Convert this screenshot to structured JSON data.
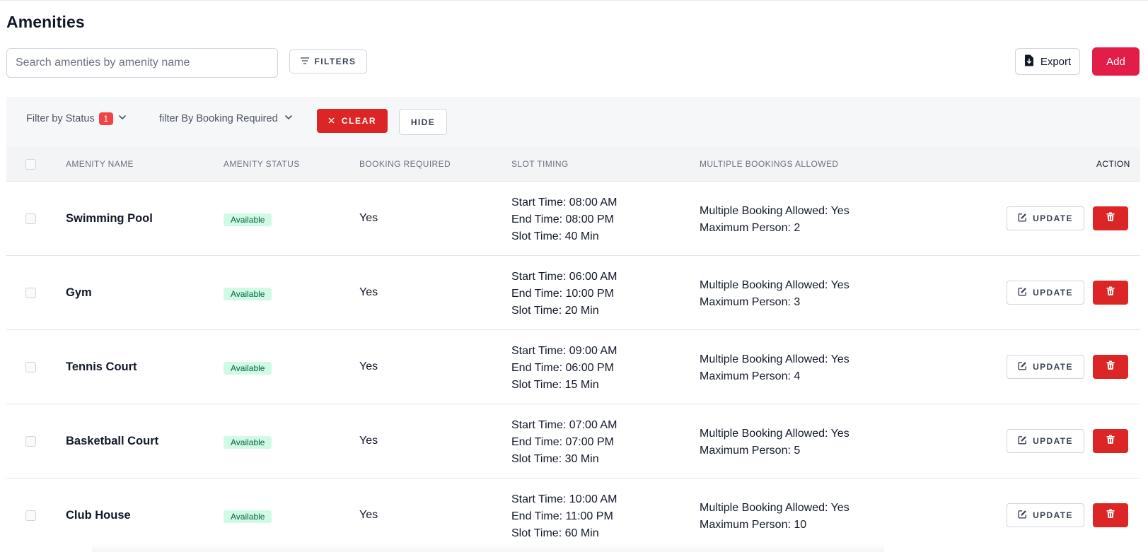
{
  "page": {
    "title": "Amenities"
  },
  "toolbar": {
    "search_placeholder": "Search amenties by amenity name",
    "filters_label": "FILTERS",
    "export_label": "Export",
    "add_label": "Add"
  },
  "filter_bar": {
    "status_label": "Filter by Status",
    "status_count": "1",
    "booking_label": "filter By Booking Required",
    "clear_label": "CLEAR",
    "hide_label": "HIDE"
  },
  "table": {
    "columns": [
      "AMENITY NAME",
      "AMENITY STATUS",
      "BOOKING REQUIRED",
      "SLOT TIMING",
      "MULTIPLE BOOKINGS ALLOWED",
      "ACTION"
    ],
    "update_label": "UPDATE",
    "rows": [
      {
        "name": "Swimming Pool",
        "status": "Available",
        "booking": "Yes",
        "start": "Start Time: 08:00 AM",
        "end": "End Time: 08:00 PM",
        "slot": "Slot Time: 40 Min",
        "multiple": "Multiple Booking Allowed: Yes",
        "max": "Maximum Person: 2"
      },
      {
        "name": "Gym",
        "status": "Available",
        "booking": "Yes",
        "start": "Start Time: 06:00 AM",
        "end": "End Time: 10:00 PM",
        "slot": "Slot Time: 20 Min",
        "multiple": "Multiple Booking Allowed: Yes",
        "max": "Maximum Person: 3"
      },
      {
        "name": "Tennis Court",
        "status": "Available",
        "booking": "Yes",
        "start": "Start Time: 09:00 AM",
        "end": "End Time: 06:00 PM",
        "slot": "Slot Time: 15 Min",
        "multiple": "Multiple Booking Allowed: Yes",
        "max": "Maximum Person: 4"
      },
      {
        "name": "Basketball Court",
        "status": "Available",
        "booking": "Yes",
        "start": "Start Time: 07:00 AM",
        "end": "End Time: 07:00 PM",
        "slot": "Slot Time: 30 Min",
        "multiple": "Multiple Booking Allowed: Yes",
        "max": "Maximum Person: 5"
      },
      {
        "name": "Club House",
        "status": "Available",
        "booking": "Yes",
        "start": "Start Time: 10:00 AM",
        "end": "End Time: 11:00 PM",
        "slot": "Slot Time: 60 Min",
        "multiple": "Multiple Booking Allowed: Yes",
        "max": "Maximum Person: 10"
      }
    ]
  },
  "icons": {
    "filters": "filter-lines-icon",
    "export": "file-download-icon",
    "status_dropdown": "chevron-down-icon",
    "clear": "close-icon",
    "update": "edit-icon",
    "delete": "trash-icon"
  },
  "colors": {
    "primary": "#e11d48",
    "danger": "#dc2626",
    "badge_bg": "#d1fae5",
    "badge_text": "#065f46",
    "header_bg": "#f3f4f6"
  }
}
